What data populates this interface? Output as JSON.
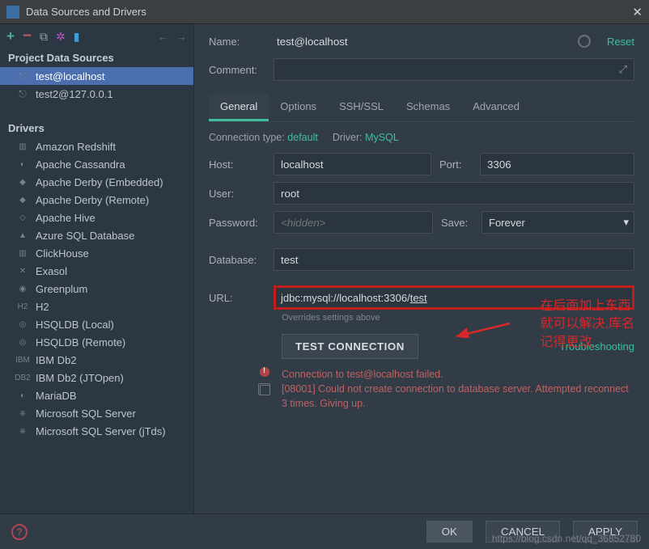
{
  "title": "Data Sources and Drivers",
  "toolbar": {
    "reset": "Reset"
  },
  "sidebar": {
    "projectHeader": "Project Data Sources",
    "sources": [
      {
        "label": "test@localhost",
        "selected": true
      },
      {
        "label": "test2@127.0.0.1",
        "selected": false
      }
    ],
    "driversHeader": "Drivers",
    "drivers": [
      "Amazon Redshift",
      "Apache Cassandra",
      "Apache Derby (Embedded)",
      "Apache Derby (Remote)",
      "Apache Hive",
      "Azure SQL Database",
      "ClickHouse",
      "Exasol",
      "Greenplum",
      "H2",
      "HSQLDB (Local)",
      "HSQLDB (Remote)",
      "IBM Db2",
      "IBM Db2 (JTOpen)",
      "MariaDB",
      "Microsoft SQL Server",
      "Microsoft SQL Server (jTds)"
    ]
  },
  "form": {
    "nameLabel": "Name:",
    "name": "test@localhost",
    "commentLabel": "Comment:",
    "tabs": [
      "General",
      "Options",
      "SSH/SSL",
      "Schemas",
      "Advanced"
    ],
    "activeTab": 0,
    "connTypeLabel": "Connection type:",
    "connType": "default",
    "driverLabel": "Driver:",
    "driver": "MySQL",
    "hostLabel": "Host:",
    "host": "localhost",
    "portLabel": "Port:",
    "port": "3306",
    "userLabel": "User:",
    "user": "root",
    "passwordLabel": "Password:",
    "passwordPlaceholder": "<hidden>",
    "saveLabel": "Save:",
    "save": "Forever",
    "dbLabel": "Database:",
    "db": "test",
    "urlLabel": "URL:",
    "urlPrefix": "jdbc:mysql://localhost:3306/",
    "urlTail": "test",
    "overrideHint": "Overrides settings above",
    "testBtn": "TEST CONNECTION",
    "troubleshoot": "Troubleshooting",
    "errLine1": "Connection to test@localhost failed.",
    "errLine2": "[08001] Could not create connection to database server. Attempted reconnect 3 times. Giving up."
  },
  "annotation": {
    "l1": "在后面加上东西",
    "l2": "就可以解决,库名",
    "l3": "记得更改"
  },
  "footer": {
    "ok": "OK",
    "cancel": "CANCEL",
    "apply": "APPLY"
  },
  "watermark": "https://blog.csdn.net/qq_36852780"
}
